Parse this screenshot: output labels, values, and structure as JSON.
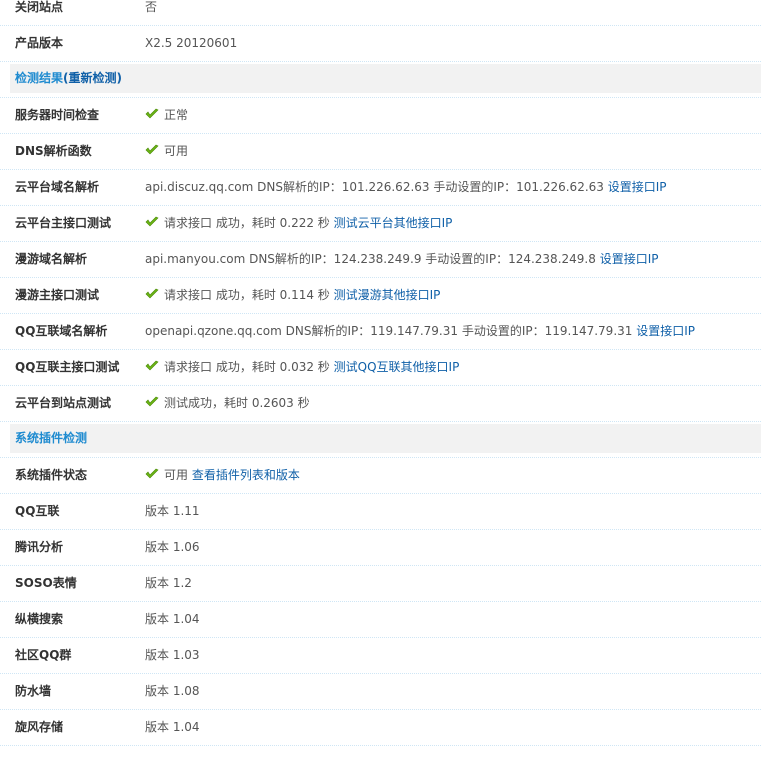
{
  "rows_top": [
    {
      "label": "关闭站点",
      "value": "否"
    },
    {
      "label": "产品版本",
      "value": "X2.5 20120601"
    }
  ],
  "section1": {
    "title": "检测结果",
    "link": "(重新检测)"
  },
  "checks": [
    {
      "label": "服务器时间检查",
      "check": true,
      "text": "正常"
    },
    {
      "label": "DNS解析函数",
      "check": true,
      "text": "可用"
    },
    {
      "label": "云平台域名解析",
      "check": false,
      "text": "api.discuz.qq.com DNS解析的IP：101.226.62.63 手动设置的IP：101.226.62.63",
      "link": "设置接口IP"
    },
    {
      "label": "云平台主接口测试",
      "check": true,
      "text": "请求接口 成功，耗时 0.222 秒",
      "link": "测试云平台其他接口IP"
    },
    {
      "label": "漫游域名解析",
      "check": false,
      "text": "api.manyou.com DNS解析的IP：124.238.249.9 手动设置的IP：124.238.249.8",
      "link": "设置接口IP"
    },
    {
      "label": "漫游主接口测试",
      "check": true,
      "text": "请求接口 成功，耗时 0.114 秒",
      "link": "测试漫游其他接口IP"
    },
    {
      "label": "QQ互联域名解析",
      "check": false,
      "text": "openapi.qzone.qq.com DNS解析的IP：119.147.79.31 手动设置的IP：119.147.79.31",
      "link": "设置接口IP"
    },
    {
      "label": "QQ互联主接口测试",
      "check": true,
      "text": "请求接口 成功，耗时 0.032 秒",
      "link": "测试QQ互联其他接口IP"
    },
    {
      "label": "云平台到站点测试",
      "check": true,
      "text": "测试成功，耗时 0.2603 秒"
    }
  ],
  "section2": {
    "title": "系统插件检测"
  },
  "plugins": [
    {
      "label": "系统插件状态",
      "check": true,
      "text": "可用",
      "link": "查看插件列表和版本"
    },
    {
      "label": "QQ互联",
      "text": "版本 1.11"
    },
    {
      "label": "腾讯分析",
      "text": "版本 1.06"
    },
    {
      "label": "SOSO表情",
      "text": "版本 1.2"
    },
    {
      "label": "纵横搜索",
      "text": "版本 1.04"
    },
    {
      "label": "社区QQ群",
      "text": "版本 1.03"
    },
    {
      "label": "防水墙",
      "text": "版本 1.08"
    },
    {
      "label": "旋风存储",
      "text": "版本 1.04"
    }
  ]
}
